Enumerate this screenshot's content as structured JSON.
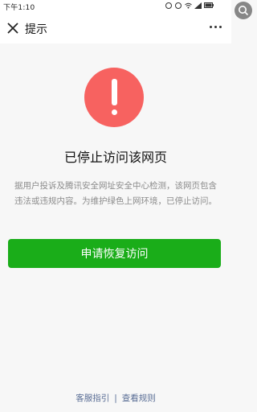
{
  "status_bar": {
    "time": "下午1:10"
  },
  "nav": {
    "title": "提示"
  },
  "main": {
    "heading": "已停止访问该网页",
    "description": "据用户投诉及腾讯安全网址安全中心检测，该网页包含违法或违规内容。为维护绿色上网环境，已停止访问。",
    "restore_button_label": "申请恢复访问"
  },
  "footer": {
    "link_guide": "客服指引",
    "separator": "|",
    "link_rules": "查看规则"
  },
  "colors": {
    "alert": "#f76260",
    "button": "#1aad19",
    "link": "#586c94"
  },
  "icons": [
    "close-icon",
    "more-icon",
    "exclamation-icon",
    "search-icon",
    "wifi-icon",
    "signal-icon",
    "battery-icon"
  ]
}
